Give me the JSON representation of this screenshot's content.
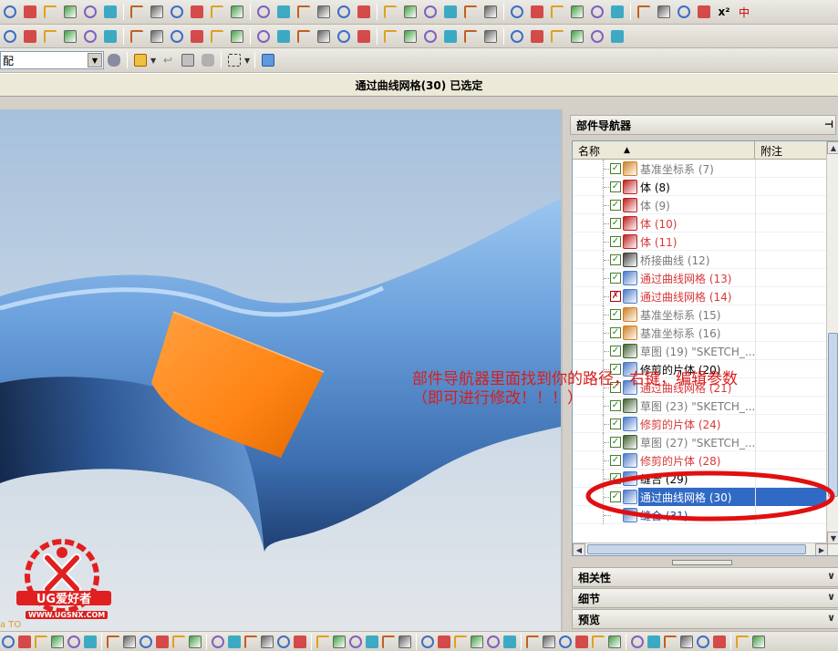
{
  "toolbar1": {
    "icons": [
      "text-icon",
      "point-icon",
      "point-set-icon",
      "fillet-icon",
      "rectangle-icon",
      "polygon-icon",
      "ellipse-icon",
      "curve-icon",
      "line-icon",
      "cone-icon",
      "surface-icon",
      "xyz-icon",
      "offset-icon",
      "arrow-icon",
      "extend-icon",
      "trim-icon",
      "bridge-icon",
      "join-icon",
      "project-icon",
      "blend-icon",
      "mesh-icon",
      "copy-icon",
      "section-icon",
      "hide-icon",
      "pen-icon",
      "edit-icon",
      "analysis-icon",
      "cap-icon",
      "mirror-icon",
      "patch-icon",
      "grid-icon",
      "xz-icon",
      "hand-icon",
      "zoom-icon"
    ],
    "x_label": "x²",
    "y_label": "中"
  },
  "toolbar2": {
    "icons": [
      "curve-fillet-icon",
      "curve-chamfer-icon",
      "corner-icon",
      "trim-corner-icon",
      "circle-icon",
      "circle-point-icon",
      "circle-tangent-icon",
      "circle-arc-icon",
      "circle-center-icon",
      "circle-edit-icon",
      "circle-more-icon",
      "box-icon",
      "box-blend-icon",
      "box-offset-icon",
      "box-shell-icon",
      "box-chamfer-icon",
      "box-unite-icon",
      "box-subtract-icon",
      "box-intersect-icon",
      "box-sew-icon",
      "sphere-icon",
      "solid-icon",
      "fill-icon",
      "face-icon",
      "wave-icon",
      "arc-icon",
      "spline-icon",
      "bracket-icon",
      "sheet-icon",
      "curve-extra-icon"
    ]
  },
  "selection": {
    "filter_value": "配"
  },
  "status_bar": {
    "message": "通过曲线网格(30) 已选定"
  },
  "navigator": {
    "title": "部件导航器",
    "pin_icon": "pin-icon",
    "columns": [
      "名称",
      "附注"
    ],
    "sort_indicator": "▲",
    "items": [
      {
        "label": "基准坐标系 (7)",
        "color": "gray",
        "icon": "datum-csys-icon",
        "check": "✓"
      },
      {
        "label": "体 (8)",
        "color": "black",
        "icon": "body-icon",
        "check": "✓"
      },
      {
        "label": "体 (9)",
        "color": "gray",
        "icon": "body-icon",
        "check": "✓"
      },
      {
        "label": "体 (10)",
        "color": "red",
        "icon": "body-icon",
        "check": "✓"
      },
      {
        "label": "体 (11)",
        "color": "red",
        "icon": "body-icon",
        "check": "✓"
      },
      {
        "label": "桥接曲线 (12)",
        "color": "gray",
        "icon": "bridge-curve-icon",
        "check": "✓"
      },
      {
        "label": "通过曲线网格 (13)",
        "color": "red",
        "icon": "curve-mesh-icon",
        "check": "✓"
      },
      {
        "label": "通过曲线网格 (14)",
        "color": "red",
        "icon": "curve-mesh-icon",
        "check": "✗"
      },
      {
        "label": "基准坐标系 (15)",
        "color": "gray",
        "icon": "datum-csys-icon",
        "check": "✓"
      },
      {
        "label": "基准坐标系 (16)",
        "color": "gray",
        "icon": "datum-csys-icon",
        "check": "✓"
      },
      {
        "label": "草图 (19) \"SKETCH_...",
        "color": "gray",
        "icon": "sketch-icon",
        "check": "✓"
      },
      {
        "label": "修剪的片体 (20)",
        "color": "black",
        "icon": "trimmed-sheet-icon",
        "check": "✓"
      },
      {
        "label": "通过曲线网格 (21)",
        "color": "red",
        "icon": "curve-mesh-icon",
        "check": "✓"
      },
      {
        "label": "草图 (23) \"SKETCH_...",
        "color": "gray",
        "icon": "sketch-icon",
        "check": "✓"
      },
      {
        "label": "修剪的片体 (24)",
        "color": "red",
        "icon": "trimmed-sheet-icon",
        "check": "✓"
      },
      {
        "label": "草图 (27) \"SKETCH_...",
        "color": "gray",
        "icon": "sketch-icon",
        "check": "✓"
      },
      {
        "label": "修剪的片体 (28)",
        "color": "red",
        "icon": "trimmed-sheet-icon",
        "check": "✓"
      },
      {
        "label": "缝合 (29)",
        "color": "black",
        "icon": "sew-icon",
        "check": "✓"
      },
      {
        "label": "通过曲线网格 (30)",
        "color": "selected",
        "icon": "curve-mesh-icon",
        "check": "✓"
      },
      {
        "label": "缝合 (31)",
        "color": "blue",
        "icon": "sew-icon",
        "check": ""
      }
    ]
  },
  "panels": {
    "dependencies": "相关性",
    "details": "细节",
    "preview": "预览"
  },
  "annotation": {
    "line1": "部件导航器里面找到你的路径，右键，编辑参数",
    "line2": "（即可进行修改！！！）"
  },
  "watermark": {
    "brand": "UG爱好者",
    "site": "WWW.UGSNX.COM"
  },
  "corner_text": "a TO",
  "colors": {
    "surface": "#6aa0dc",
    "patch": "#ff8a1a",
    "annotation": "#d81e1e",
    "selection": "#316ac5"
  }
}
